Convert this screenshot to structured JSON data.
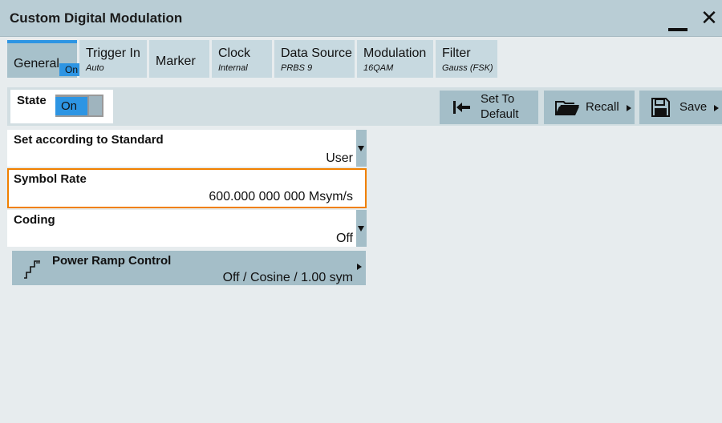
{
  "window": {
    "title": "Custom Digital Modulation",
    "minimize_icon": "minimize-icon",
    "close_icon": "close-icon",
    "close_glyph": "✕"
  },
  "tabs": [
    {
      "label": "General",
      "sub": "",
      "badge": "On",
      "active": true
    },
    {
      "label": "Trigger In",
      "sub": "Auto"
    },
    {
      "label": "Marker",
      "sub": ""
    },
    {
      "label": "Clock",
      "sub": "Internal"
    },
    {
      "label": "Data Source",
      "sub": "PRBS 9"
    },
    {
      "label": "Modulation",
      "sub": "16QAM"
    },
    {
      "label": "Filter",
      "sub": "Gauss (FSK)"
    }
  ],
  "toolbar": {
    "state_label": "State",
    "state_value": "On",
    "set_to_default_line1": "Set To",
    "set_to_default_line2": "Default",
    "recall_label": "Recall",
    "save_label": "Save",
    "icons": {
      "set_to_default": "arrow-to-left-icon",
      "recall": "folder-icon",
      "save": "floppy-disk-icon"
    }
  },
  "fields": {
    "standard": {
      "label": "Set according to Standard",
      "value": "User"
    },
    "symbol_rate": {
      "label": "Symbol Rate",
      "value": "600.000 000 000 Msym/s"
    },
    "coding": {
      "label": "Coding",
      "value": "Off"
    }
  },
  "power_ramp": {
    "label": "Power Ramp Control",
    "value": "Off / Cosine / 1.00 sym",
    "icon": "ramp-icon"
  },
  "colors": {
    "accent": "#2d95e3",
    "highlight": "#f08000",
    "titlebar": "#b9cdd5",
    "button": "#a4bec8"
  }
}
